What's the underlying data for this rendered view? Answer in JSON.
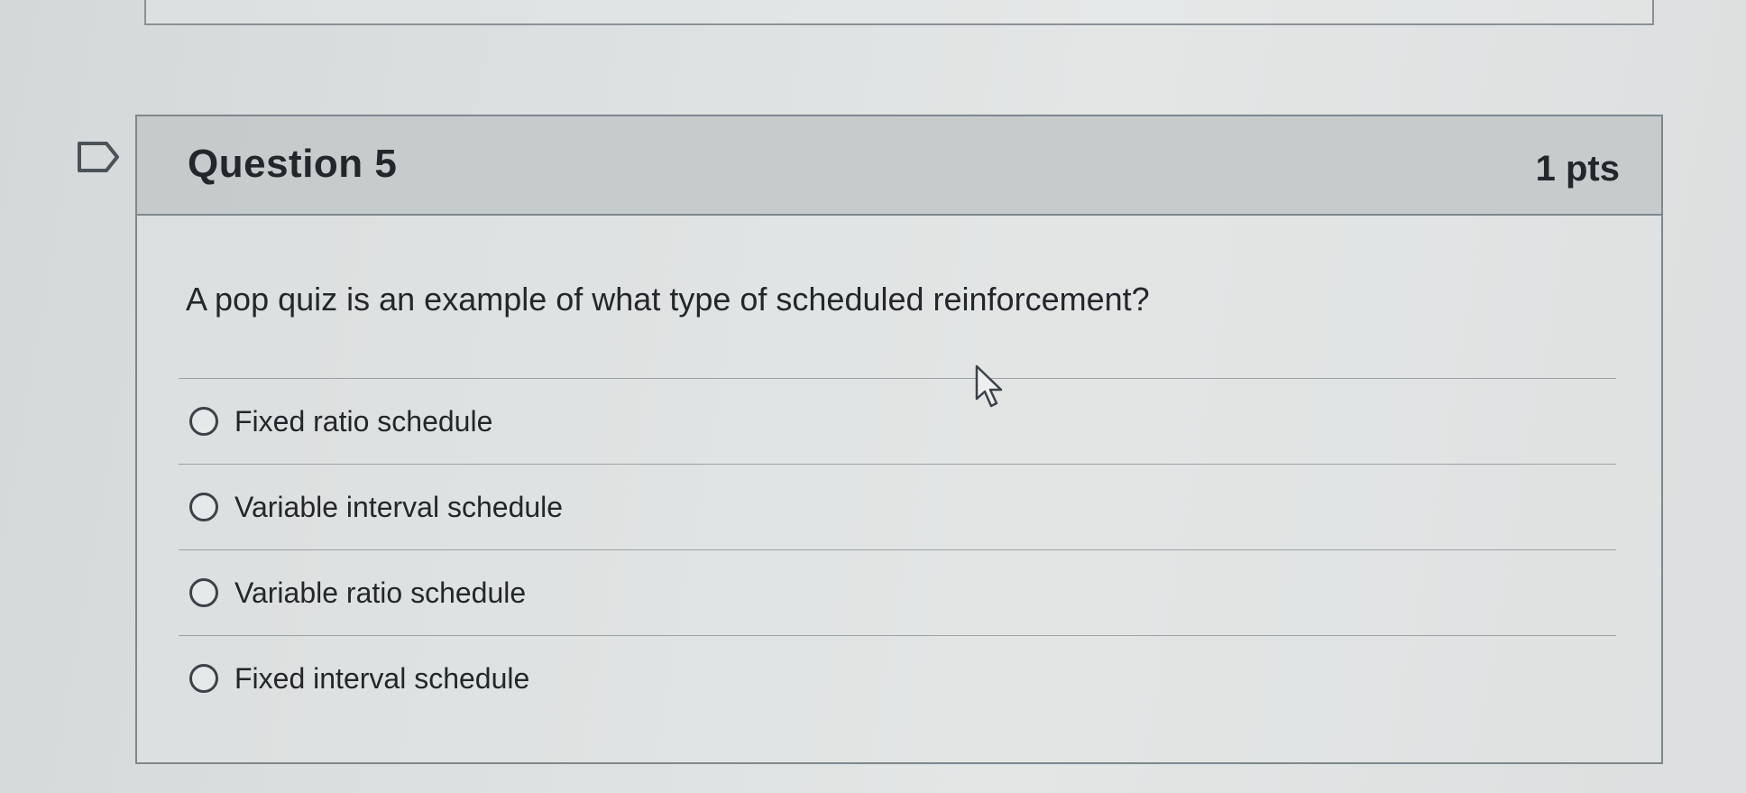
{
  "question": {
    "title": "Question 5",
    "points": "1 pts",
    "text": "A pop quiz is an example of what type of scheduled reinforcement?",
    "answers": [
      {
        "label": "Fixed ratio schedule"
      },
      {
        "label": "Variable interval schedule"
      },
      {
        "label": "Variable ratio schedule"
      },
      {
        "label": "Fixed interval schedule"
      }
    ]
  },
  "icons": {
    "flag": "flag-icon",
    "cursor": "mouse-pointer-icon"
  },
  "colors": {
    "text": "#23272b",
    "header_background": "#c2c7c8",
    "border": "#7e878c"
  }
}
